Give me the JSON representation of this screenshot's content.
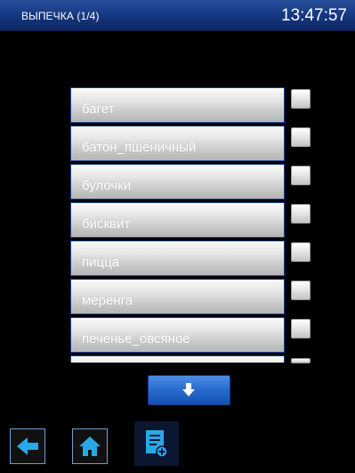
{
  "header": {
    "title": "ВЫПЕЧКА (1/4)",
    "clock": "13:47:57"
  },
  "list": {
    "items": [
      {
        "label": "багет"
      },
      {
        "label": "батон_пшеничный"
      },
      {
        "label": "булочки"
      },
      {
        "label": "бисквит"
      },
      {
        "label": "пицца"
      },
      {
        "label": "меренга"
      },
      {
        "label": "печенье_овсяное"
      }
    ]
  },
  "colors": {
    "header": "#173a84",
    "accent": "#2b6dd0",
    "icon": "#29a8e8"
  },
  "icons": {
    "scroll": "arrow-down-icon",
    "back": "arrow-left-icon",
    "home": "home-icon",
    "new": "document-add-icon"
  }
}
